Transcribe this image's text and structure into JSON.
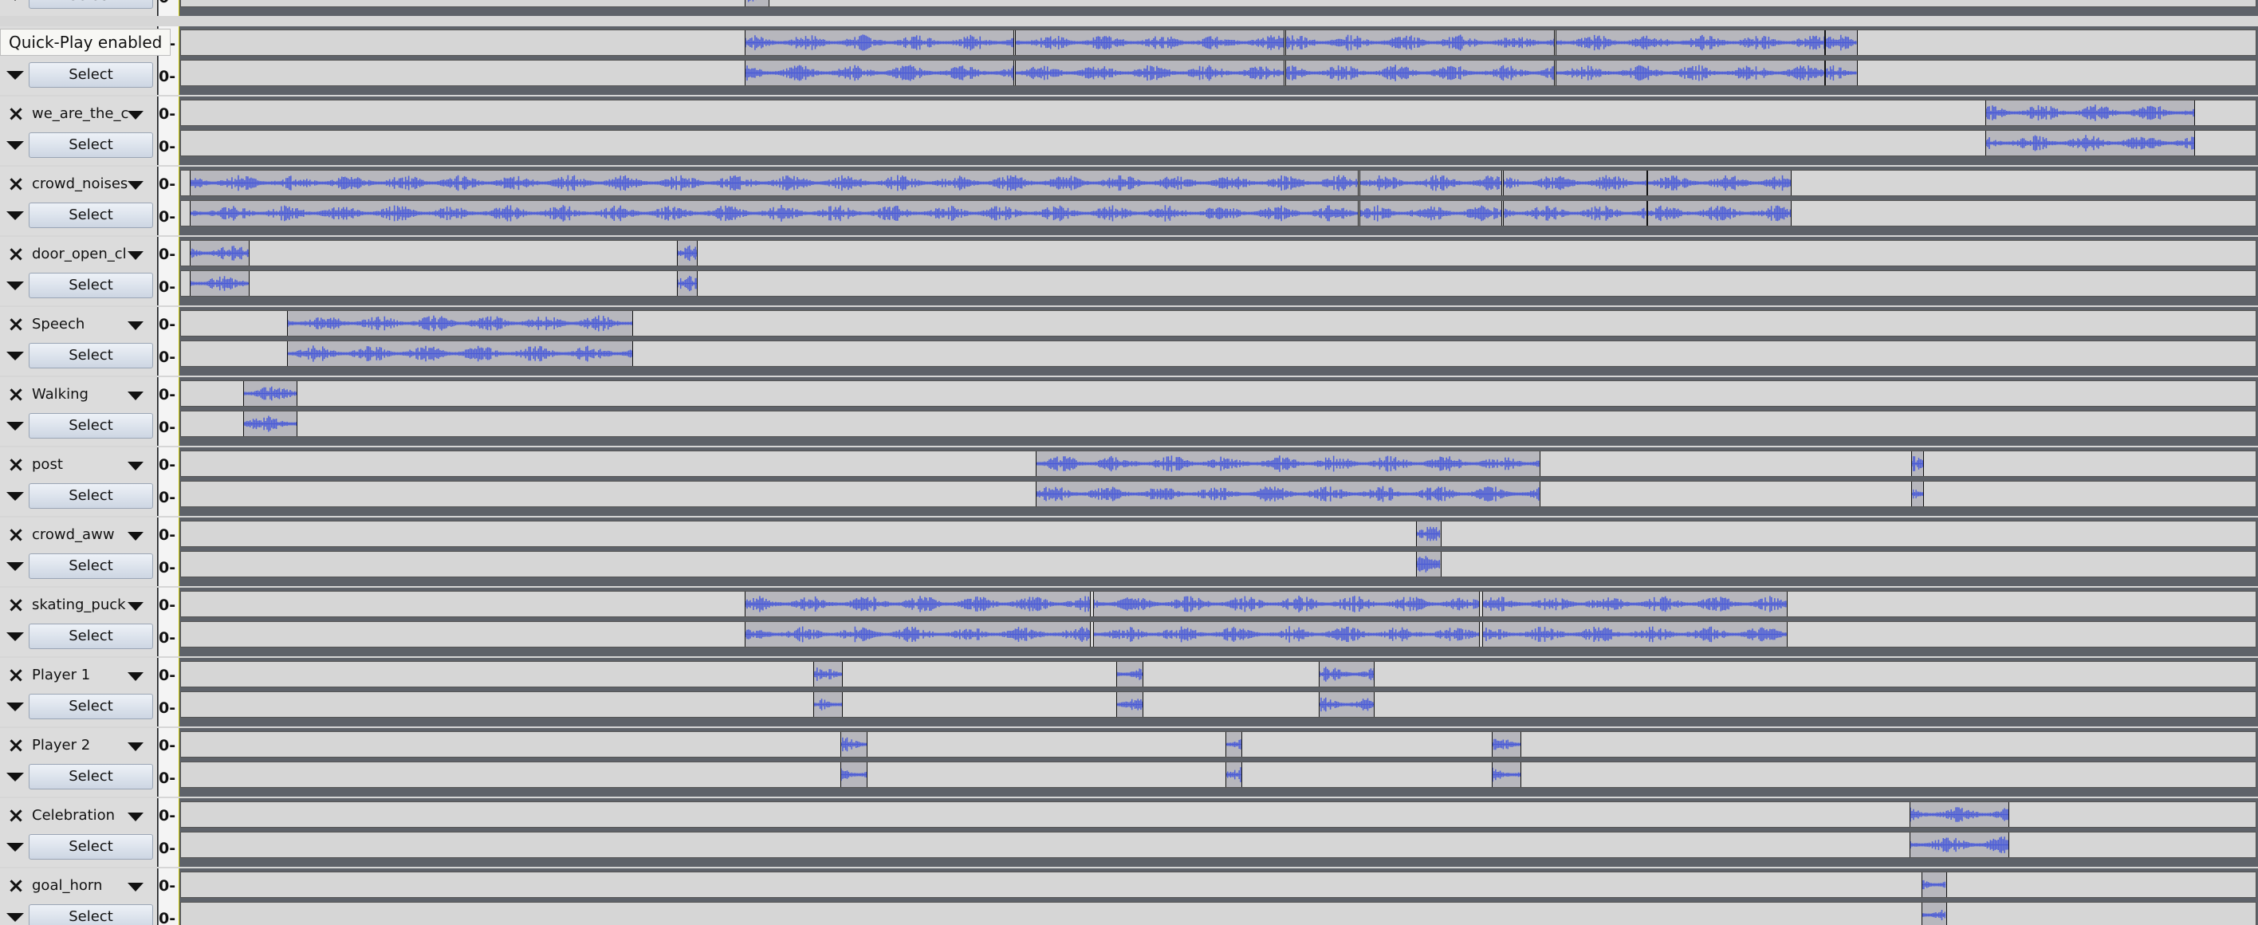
{
  "tooltip": "Quick-Play enabled",
  "zero_label": "0-",
  "select_label": "Select",
  "tracks": [
    {
      "id": "t0",
      "name": "",
      "clips": [
        [
          0.2716,
          0.012
        ]
      ]
    },
    {
      "id": "t1",
      "name": "",
      "clips": [
        [
          0.2716,
          0.1298
        ],
        [
          0.4017,
          0.1298
        ],
        [
          0.5318,
          0.1298
        ],
        [
          0.6619,
          0.1298
        ],
        [
          0.792,
          0.0156
        ]
      ]
    },
    {
      "id": "t2",
      "name": "we_are_the_c",
      "clips": [
        [
          0.8691,
          0.101
        ]
      ]
    },
    {
      "id": "t3",
      "name": "crowd_noises",
      "clips": [
        [
          0.0042,
          0.563
        ],
        [
          0.5677,
          0.0687
        ],
        [
          0.6367,
          0.0694
        ],
        [
          0.7063,
          0.0693
        ]
      ]
    },
    {
      "id": "t4",
      "name": "door_open_cl",
      "clips": [
        [
          0.0042,
          0.029
        ],
        [
          0.239,
          0.01
        ]
      ]
    },
    {
      "id": "t5",
      "name": "Speech",
      "clips": [
        [
          0.0511,
          0.1665
        ]
      ]
    },
    {
      "id": "t6",
      "name": "Walking",
      "clips": [
        [
          0.03,
          0.026
        ]
      ]
    },
    {
      "id": "t7",
      "name": "post",
      "clips": [
        [
          0.4116,
          0.243
        ],
        [
          0.8335,
          0.006
        ]
      ]
    },
    {
      "id": "t8",
      "name": "crowd_aww",
      "clips": [
        [
          0.595,
          0.012
        ]
      ]
    },
    {
      "id": "t9",
      "name": "skating_puck",
      "clips": [
        [
          0.2716,
          0.1667
        ],
        [
          0.4395,
          0.186
        ],
        [
          0.6267,
          0.147
        ]
      ]
    },
    {
      "id": "t10",
      "name": "Player 1",
      "clips": [
        [
          0.3046,
          0.014
        ],
        [
          0.4505,
          0.013
        ],
        [
          0.548,
          0.027
        ]
      ]
    },
    {
      "id": "t11",
      "name": "Player 2",
      "clips": [
        [
          0.3176,
          0.013
        ],
        [
          0.503,
          0.008
        ],
        [
          0.6315,
          0.014
        ]
      ]
    },
    {
      "id": "t12",
      "name": "Celebration",
      "clips": [
        [
          0.8325,
          0.048
        ]
      ]
    },
    {
      "id": "t13",
      "name": "goal_horn",
      "clips": [
        [
          0.8385,
          0.012
        ]
      ]
    }
  ]
}
